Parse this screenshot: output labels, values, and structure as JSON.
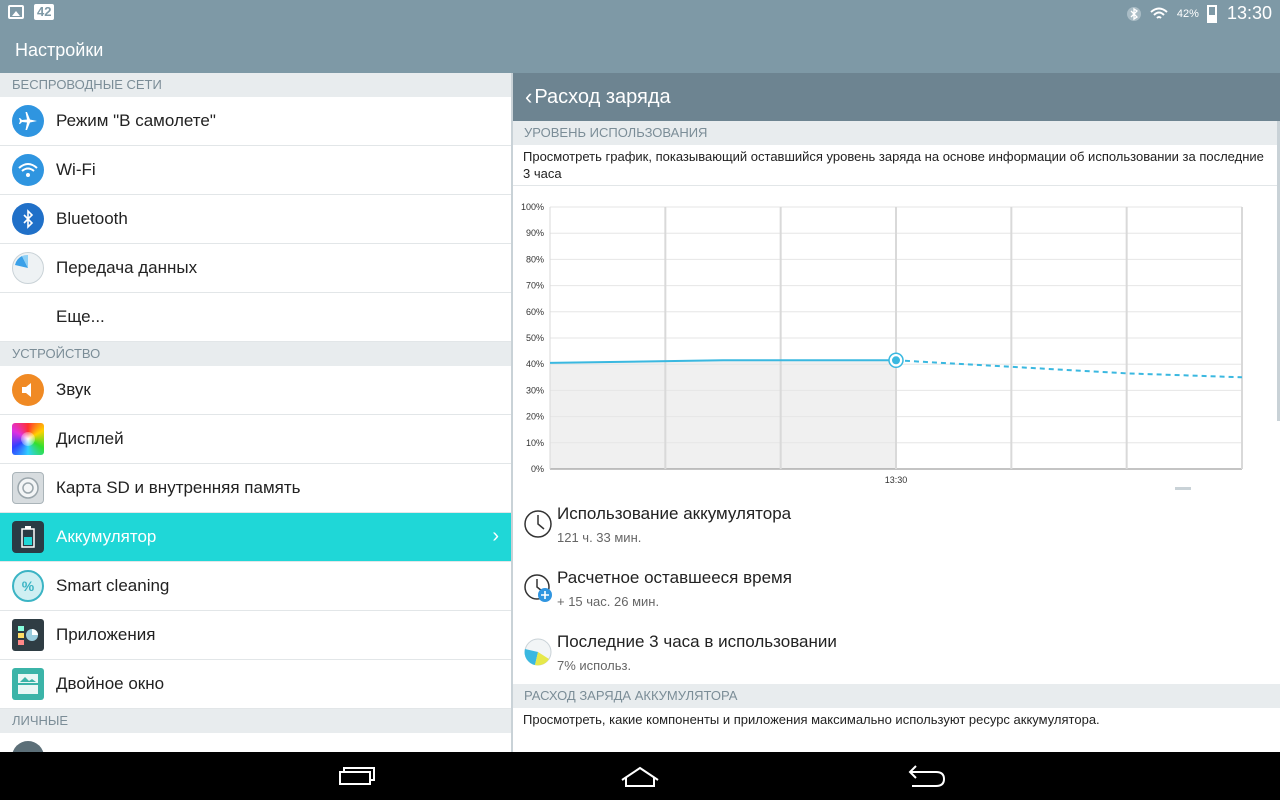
{
  "statusbar": {
    "badge": "42",
    "battery_pct": "42%",
    "battery_level": 0.42,
    "time": "13:30"
  },
  "actionbar": {
    "title": "Настройки"
  },
  "sidebar": {
    "sections": [
      {
        "header": "БЕСПРОВОДНЫЕ СЕТИ",
        "items": [
          {
            "label": "Режим \"В самолете\"",
            "icon": "airplane-icon"
          },
          {
            "label": "Wi-Fi",
            "icon": "wifi-icon"
          },
          {
            "label": "Bluetooth",
            "icon": "bluetooth-icon"
          },
          {
            "label": "Передача данных",
            "icon": "data-usage-icon"
          },
          {
            "label": "Еще..."
          }
        ]
      },
      {
        "header": "УСТРОЙСТВО",
        "items": [
          {
            "label": "Звук",
            "icon": "sound-icon"
          },
          {
            "label": "Дисплей",
            "icon": "display-icon"
          },
          {
            "label": "Карта SD и внутренняя память",
            "icon": "storage-icon"
          },
          {
            "label": "Аккумулятор",
            "icon": "battery-icon",
            "active": true
          },
          {
            "label": "Smart cleaning",
            "icon": "smart-cleaning-icon"
          },
          {
            "label": "Приложения",
            "icon": "apps-icon"
          },
          {
            "label": "Двойное окно",
            "icon": "dual-window-icon"
          }
        ]
      },
      {
        "header": "ЛИЧНЫЕ"
      }
    ]
  },
  "detail": {
    "title": "Расход заряда",
    "usage_section": "УРОВЕНЬ ИСПОЛЬЗОВАНИЯ",
    "usage_desc": "Просмотреть график, показывающий оставшийся уровень заряда на основе информации об использовании за последние 3 часа",
    "stats": [
      {
        "title": "Использование аккумулятора",
        "sub": "121 ч. 33 мин.",
        "icon": "clock-icon"
      },
      {
        "title": "Расчетное оставшееся время",
        "sub": "+ 15 час. 26 мин.",
        "icon": "clock-plus-icon"
      },
      {
        "title": "Последние 3 часа в использовании",
        "sub": "7% использ.",
        "icon": "pie-usage-icon"
      }
    ],
    "consumption_section": "РАСХОД ЗАРЯДА АККУМУЛЯТОРА",
    "consumption_desc": "Просмотреть, какие компоненты и приложения максимально используют ресурс аккумулятора."
  },
  "colors": {
    "accent": "#1fd7d7",
    "header": "#7e99a6",
    "line": "#3ab8e0"
  },
  "chart_data": {
    "type": "line",
    "y_ticks": [
      "0%",
      "10%",
      "20%",
      "30%",
      "40%",
      "50%",
      "60%",
      "70%",
      "80%",
      "90%",
      "100%"
    ],
    "ylim": [
      0,
      100
    ],
    "x_tick_labels": [
      "13:30"
    ],
    "xlim": [
      -3,
      3
    ],
    "grid": true,
    "series": [
      {
        "style": "solid",
        "points": [
          [
            -3,
            40.5
          ],
          [
            -1.5,
            41.5
          ],
          [
            0,
            41.5
          ]
        ]
      },
      {
        "style": "dashed",
        "points": [
          [
            0,
            41.5
          ],
          [
            1,
            39
          ],
          [
            2,
            36.5
          ],
          [
            3,
            35
          ]
        ]
      }
    ],
    "current_point": [
      0,
      41.5
    ]
  }
}
